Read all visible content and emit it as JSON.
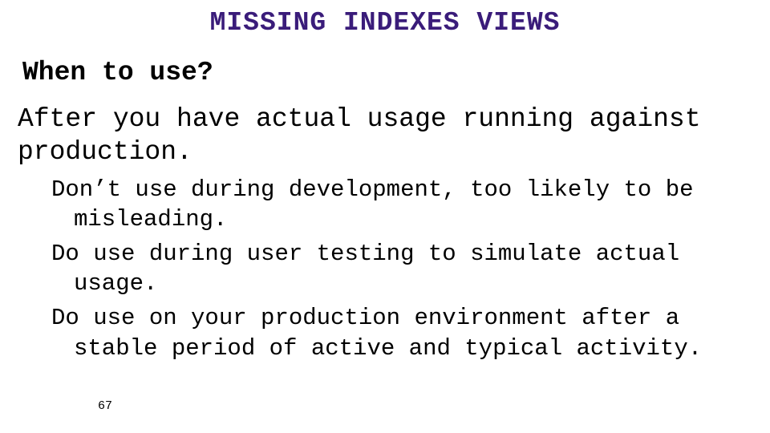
{
  "slide": {
    "title": "MISSING INDEXES VIEWS",
    "subheading": "When to use?",
    "lead": "After you have actual usage running against production.",
    "bullets": [
      "Don’t use during development, too likely to be misleading.",
      "Do use during user testing to simulate actual usage.",
      "Do use on your production environment after a stable period of active and typical activity."
    ],
    "page_number": "67"
  }
}
